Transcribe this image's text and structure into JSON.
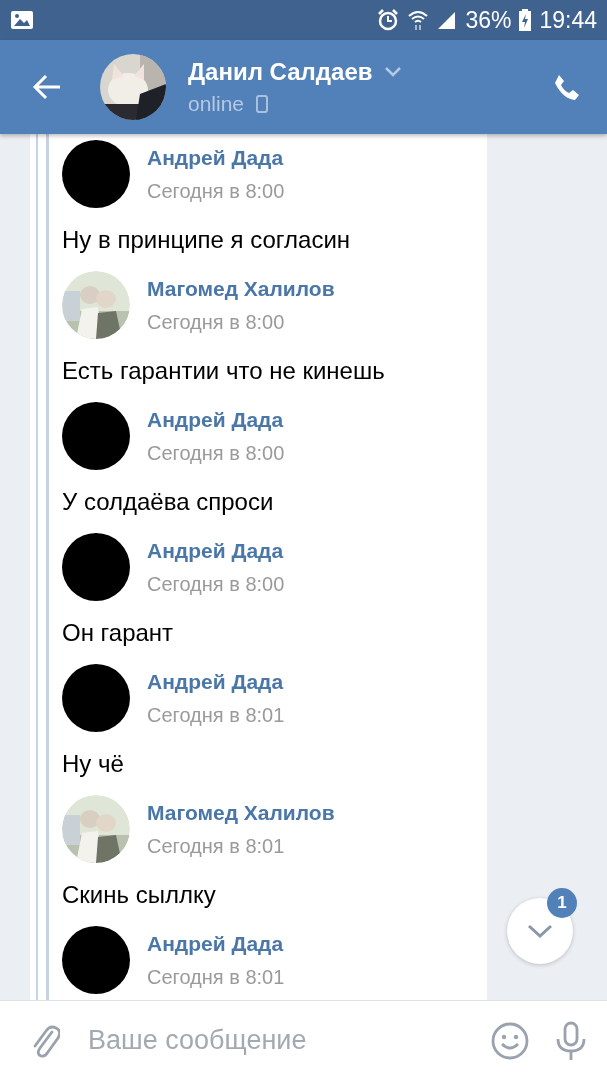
{
  "status_bar": {
    "battery": "36%",
    "time": "19:44"
  },
  "header": {
    "name": "Данил Салдаев",
    "status": "online"
  },
  "messages": [
    {
      "author": "Андрей Дада",
      "avatar": {
        "kind": "blank"
      },
      "time": "Сегодня в 8:00",
      "text": "Ну в принципе я согласин"
    },
    {
      "author": "Магомед Халилов",
      "time": "Сегодня в 8:00",
      "text": "Есть гарантии что не кинешь"
    },
    {
      "author": "Андрей Дада",
      "avatar": {
        "kind": "blank"
      },
      "time": "Сегодня в 8:00",
      "text": "У солдаёва спроси"
    },
    {
      "author": "Андрей Дада",
      "avatar": {
        "kind": "blank"
      },
      "time": "Сегодня в 8:00",
      "text": "Он гарант"
    },
    {
      "author": "Андрей Дада",
      "avatar": {
        "kind": "blank"
      },
      "time": "Сегодня в 8:01",
      "text": "Ну чё"
    },
    {
      "author": "Магомед Халилов",
      "time": "Сегодня в 8:01",
      "text": "Скинь сыллку"
    },
    {
      "author": "Андрей Дада",
      "avatar": {
        "kind": "blank"
      },
      "time": "Сегодня в 8:01"
    }
  ],
  "scroll_button": {
    "badge": "1"
  },
  "composer": {
    "placeholder": "Ваше сообщение"
  }
}
